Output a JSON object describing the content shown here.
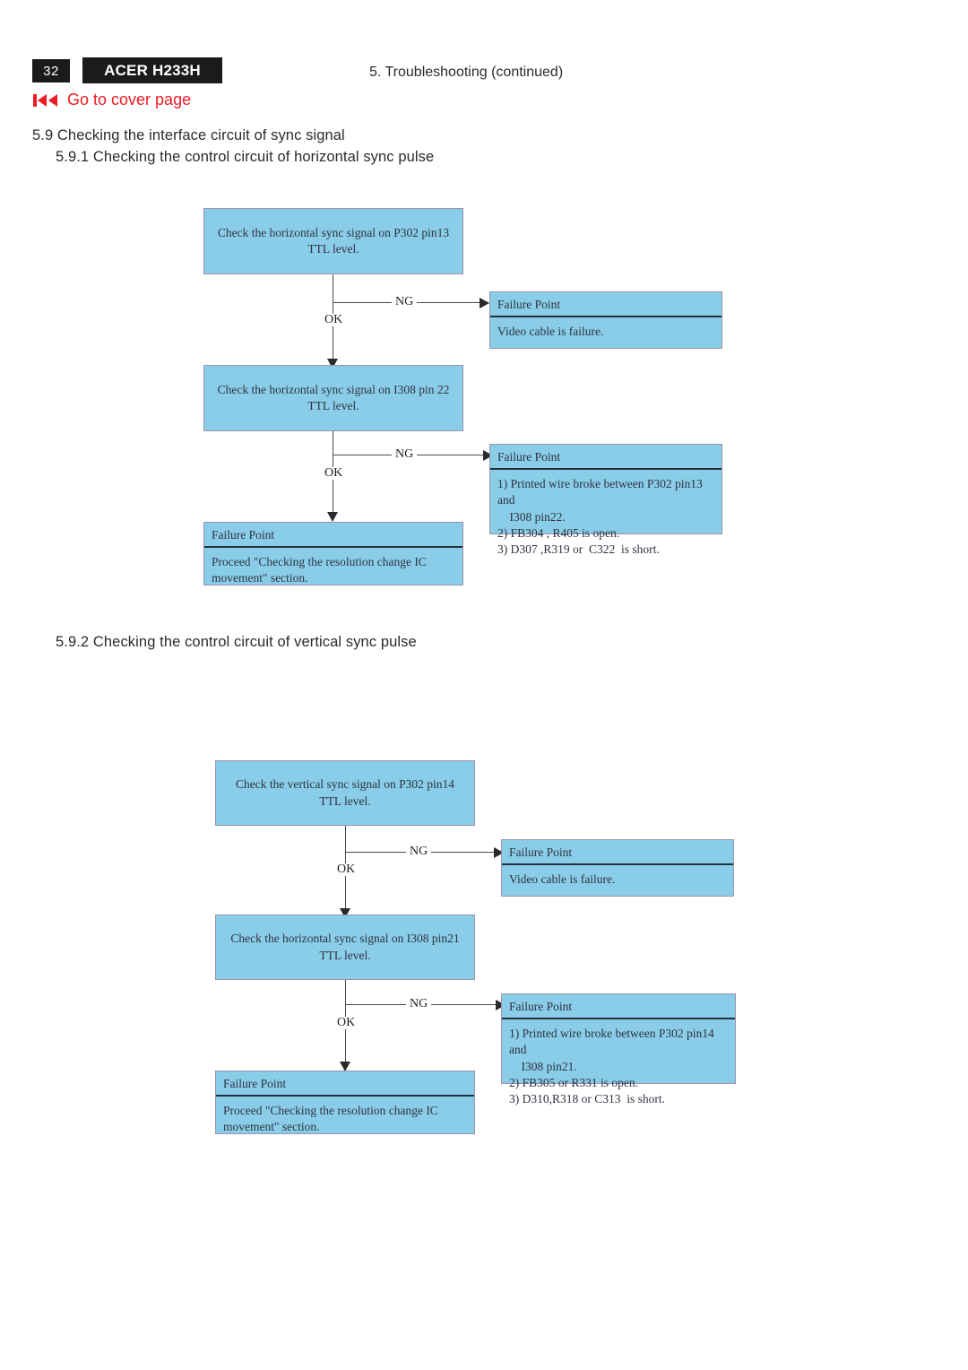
{
  "header": {
    "page_number": "32",
    "model": "ACER H233H",
    "section_title": "5. Troubleshooting (continued)",
    "cover_link_label": "Go to cover page",
    "cover_link_icon": "rewind-to-start-icon",
    "accent_color": "#ee1b24",
    "badge_color": "#1b1b1b"
  },
  "headings": {
    "h59": "5.9 Checking the interface circuit of sync signal",
    "h591": "5.9.1 Checking the control circuit of horizontal sync pulse",
    "h592": "5.9.2 Checking the control circuit of vertical sync pulse"
  },
  "flow_colors": {
    "box_fill": "#8ACDE9",
    "box_border": "#9a93ae",
    "divider": "#22303c",
    "connector": "#4a4a4a"
  },
  "edge_labels": {
    "ng": "NG",
    "ok": "OK"
  },
  "chart1": {
    "step1": "Check the horizontal sync signal on P302 pin13 TTL level.",
    "fail1_head": "Failure Point",
    "fail1_body": "Video cable is failure.",
    "step2": "Check the horizontal sync signal on I308 pin 22 TTL level.",
    "fail2_head": "Failure Point",
    "fail2_line1": "1) Printed wire broke between P302 pin13 and",
    "fail2_line2": "    I308 pin22.",
    "fail2_line3": "2) FB304 , R405 is open.",
    "fail2_line4": "3) D307 ,R319 or  C322  is short.",
    "final_head": "Failure Point",
    "final_body": "Proceed \"Checking the resolution change IC movement\" section."
  },
  "chart2": {
    "step1": "Check the vertical sync signal on P302 pin14 TTL level.",
    "fail1_head": "Failure Point",
    "fail1_body": "Video cable is failure.",
    "step2": "Check the horizontal sync signal on I308 pin21 TTL level.",
    "fail2_head": "Failure Point",
    "fail2_line1": "1) Printed wire broke between P302 pin14 and",
    "fail2_line2": "    I308 pin21.",
    "fail2_line3": "2) FB305 or R331 is open.",
    "fail2_line4": "3) D310,R318 or C313  is short.",
    "final_head": "Failure Point",
    "final_body": "Proceed \"Checking the resolution change IC movement\" section."
  }
}
